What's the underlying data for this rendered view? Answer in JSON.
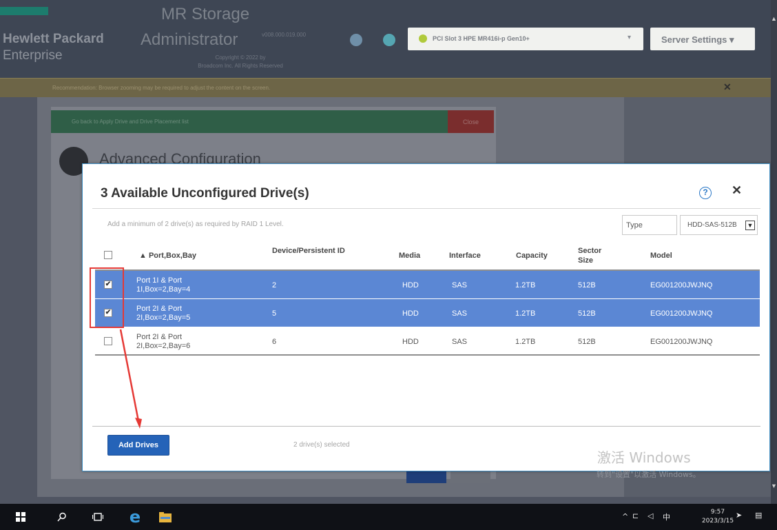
{
  "header": {
    "brand_bold": "Hewlett Packard",
    "brand_line2": "Enterprise",
    "app_title": "MR Storage",
    "app_title2": "Administrator",
    "version": "v008.000.019.000",
    "copyright_line1": "Copyright © 2022 by",
    "copyright_line2": "Broadcom Inc. All Rights Reserved",
    "slot_selector": "PCI Slot 3 HPE MR416i-p Gen10+",
    "server_settings": "Server Settings"
  },
  "notice": {
    "text": "Recommendation: Browser zooming may be required to adjust the content on the screen."
  },
  "background": {
    "back_link": "Go back to Apply Drive and Drive Placement list",
    "close_label": "Close",
    "heading": "Advanced Configuration"
  },
  "modal": {
    "title": "3 Available Unconfigured Drive(s)",
    "hint": "Add a minimum of 2 drive(s) as required by RAID 1 Level.",
    "type_label": "Type",
    "type_value": "HDD-SAS-512B",
    "columns": [
      "Port,Box,Bay",
      "Device/Persistent ID",
      "Media",
      "Interface",
      "Capacity",
      "Sector Size",
      "Model"
    ],
    "rows": [
      {
        "checked": true,
        "port": "Port 1I & Port 1I,Box=2,Bay=4",
        "id": "2",
        "media": "HDD",
        "interface": "SAS",
        "capacity": "1.2TB",
        "sector": "512B",
        "model": "EG001200JWJNQ"
      },
      {
        "checked": true,
        "port": "Port 2I & Port 2I,Box=2,Bay=5",
        "id": "5",
        "media": "HDD",
        "interface": "SAS",
        "capacity": "1.2TB",
        "sector": "512B",
        "model": "EG001200JWJNQ"
      },
      {
        "checked": false,
        "port": "Port 2I & Port 2I,Box=2,Bay=6",
        "id": "6",
        "media": "HDD",
        "interface": "SAS",
        "capacity": "1.2TB",
        "sector": "512B",
        "model": "EG001200JWJNQ"
      }
    ],
    "add_button": "Add Drives",
    "selected_status": "2 drive(s) selected"
  },
  "watermark": {
    "line1": "激活 Windows",
    "line2": "转到\"设置\"以激活 Windows。"
  },
  "taskbar": {
    "ime": "中",
    "time": "9:57",
    "date": "2023/3/15"
  }
}
